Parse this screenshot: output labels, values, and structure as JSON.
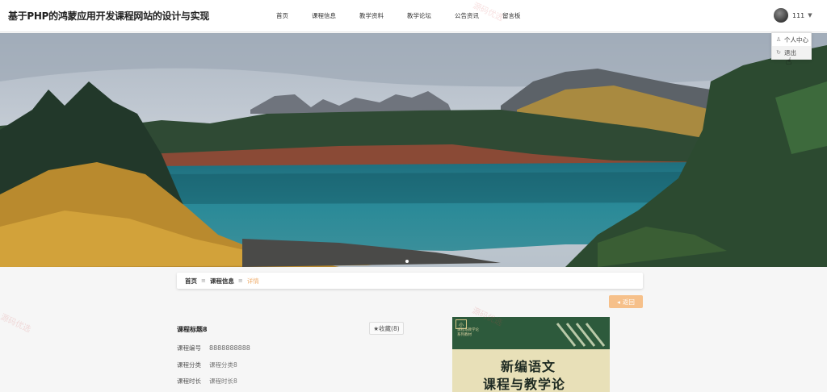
{
  "header": {
    "site_title": "基于PHP的鸿蒙应用开发课程网站的设计与实现",
    "nav": [
      "首页",
      "课程信息",
      "教学资料",
      "教学论坛",
      "公告资讯",
      "留言板"
    ],
    "user": {
      "name": "111",
      "caret": "▼"
    }
  },
  "dropdown": {
    "items": [
      {
        "icon": "user-icon",
        "glyph": "♙",
        "label": "个人中心"
      },
      {
        "icon": "logout-icon",
        "glyph": "↻",
        "label": "退出"
      }
    ]
  },
  "breadcrumb": {
    "items": [
      "首页",
      "课程信息",
      "详情"
    ],
    "sep": "≡"
  },
  "back_button": {
    "glyph": "◂",
    "label": "返回"
  },
  "detail": {
    "title": "课程标题8",
    "favorite": {
      "glyph": "★",
      "label": "收藏(8)"
    },
    "fields": [
      {
        "label": "课程编号",
        "value": "8888888888"
      },
      {
        "label": "课程分类",
        "value": "课程分类8"
      },
      {
        "label": "课程时长",
        "value": "课程时长8"
      }
    ]
  },
  "cover": {
    "badge": "小",
    "small_text": "课程与教学论\n系列教材",
    "title_line1": "新编语文",
    "title_line2": "课程与教学论"
  },
  "watermark": "源码优选",
  "colors": {
    "accent": "#f6c08a",
    "crumb_current": "#f0b070"
  }
}
